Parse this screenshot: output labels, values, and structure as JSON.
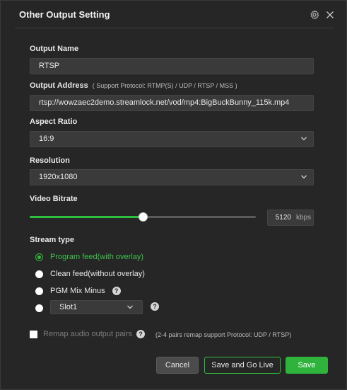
{
  "dialog": {
    "title": "Other Output Setting"
  },
  "output_name": {
    "label": "Output Name",
    "value": "RTSP"
  },
  "output_address": {
    "label": "Output Address",
    "hint": "( Support Protocol: RTMP(S) / UDP / RTSP / MSS )",
    "value": "rtsp://wowzaec2demo.streamlock.net/vod/mp4:BigBuckBunny_115k.mp4"
  },
  "aspect_ratio": {
    "label": "Aspect Ratio",
    "value": "16:9"
  },
  "resolution": {
    "label": "Resolution",
    "value": "1920x1080"
  },
  "video_bitrate": {
    "label": "Video Bitrate",
    "value": "5120",
    "unit": "kbps",
    "level_fraction": 0.5
  },
  "stream_type": {
    "label": "Stream type",
    "options": [
      {
        "label": "Program feed(with overlay)",
        "selected": true
      },
      {
        "label": "Clean feed(without overlay)",
        "selected": false
      },
      {
        "label": "PGM Mix Minus",
        "selected": false
      },
      {
        "label": "",
        "selected": false
      }
    ],
    "slot_value": "Slot1"
  },
  "remap": {
    "label": "Remap audio output pairs",
    "hint": "(2-4 pairs remap support Protocol: UDP / RTSP)",
    "checked": false
  },
  "help_glyph": "?",
  "buttons": {
    "cancel": "Cancel",
    "save_and_go_live": "Save and Go Live",
    "save": "Save"
  },
  "colors": {
    "accent": "#2fbf3f",
    "background": "#262626",
    "field": "#3a3a3a"
  }
}
